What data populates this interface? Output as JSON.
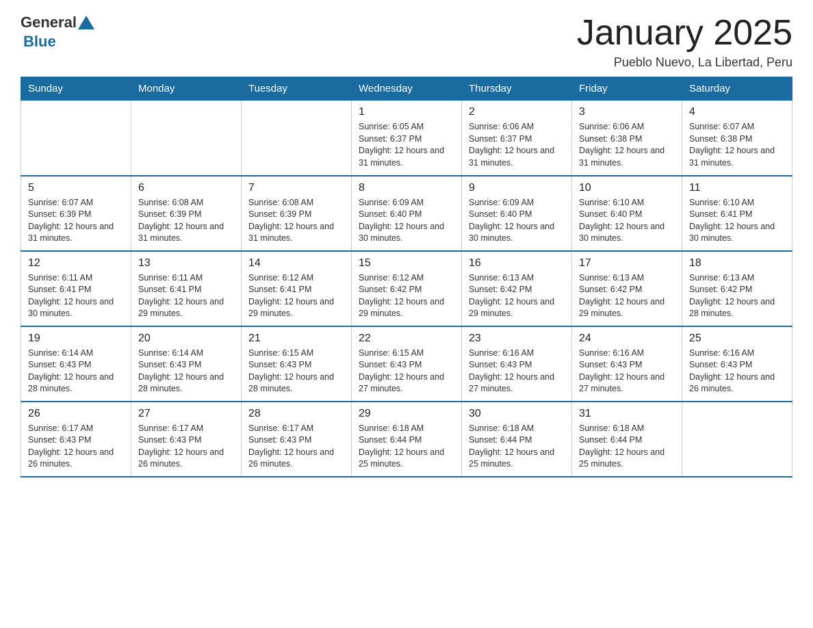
{
  "header": {
    "logo_general": "General",
    "logo_blue": "Blue",
    "month_title": "January 2025",
    "location": "Pueblo Nuevo, La Libertad, Peru"
  },
  "days_of_week": [
    "Sunday",
    "Monday",
    "Tuesday",
    "Wednesday",
    "Thursday",
    "Friday",
    "Saturday"
  ],
  "weeks": [
    [
      {
        "day": "",
        "info": ""
      },
      {
        "day": "",
        "info": ""
      },
      {
        "day": "",
        "info": ""
      },
      {
        "day": "1",
        "info": "Sunrise: 6:05 AM\nSunset: 6:37 PM\nDaylight: 12 hours and 31 minutes."
      },
      {
        "day": "2",
        "info": "Sunrise: 6:06 AM\nSunset: 6:37 PM\nDaylight: 12 hours and 31 minutes."
      },
      {
        "day": "3",
        "info": "Sunrise: 6:06 AM\nSunset: 6:38 PM\nDaylight: 12 hours and 31 minutes."
      },
      {
        "day": "4",
        "info": "Sunrise: 6:07 AM\nSunset: 6:38 PM\nDaylight: 12 hours and 31 minutes."
      }
    ],
    [
      {
        "day": "5",
        "info": "Sunrise: 6:07 AM\nSunset: 6:39 PM\nDaylight: 12 hours and 31 minutes."
      },
      {
        "day": "6",
        "info": "Sunrise: 6:08 AM\nSunset: 6:39 PM\nDaylight: 12 hours and 31 minutes."
      },
      {
        "day": "7",
        "info": "Sunrise: 6:08 AM\nSunset: 6:39 PM\nDaylight: 12 hours and 31 minutes."
      },
      {
        "day": "8",
        "info": "Sunrise: 6:09 AM\nSunset: 6:40 PM\nDaylight: 12 hours and 30 minutes."
      },
      {
        "day": "9",
        "info": "Sunrise: 6:09 AM\nSunset: 6:40 PM\nDaylight: 12 hours and 30 minutes."
      },
      {
        "day": "10",
        "info": "Sunrise: 6:10 AM\nSunset: 6:40 PM\nDaylight: 12 hours and 30 minutes."
      },
      {
        "day": "11",
        "info": "Sunrise: 6:10 AM\nSunset: 6:41 PM\nDaylight: 12 hours and 30 minutes."
      }
    ],
    [
      {
        "day": "12",
        "info": "Sunrise: 6:11 AM\nSunset: 6:41 PM\nDaylight: 12 hours and 30 minutes."
      },
      {
        "day": "13",
        "info": "Sunrise: 6:11 AM\nSunset: 6:41 PM\nDaylight: 12 hours and 29 minutes."
      },
      {
        "day": "14",
        "info": "Sunrise: 6:12 AM\nSunset: 6:41 PM\nDaylight: 12 hours and 29 minutes."
      },
      {
        "day": "15",
        "info": "Sunrise: 6:12 AM\nSunset: 6:42 PM\nDaylight: 12 hours and 29 minutes."
      },
      {
        "day": "16",
        "info": "Sunrise: 6:13 AM\nSunset: 6:42 PM\nDaylight: 12 hours and 29 minutes."
      },
      {
        "day": "17",
        "info": "Sunrise: 6:13 AM\nSunset: 6:42 PM\nDaylight: 12 hours and 29 minutes."
      },
      {
        "day": "18",
        "info": "Sunrise: 6:13 AM\nSunset: 6:42 PM\nDaylight: 12 hours and 28 minutes."
      }
    ],
    [
      {
        "day": "19",
        "info": "Sunrise: 6:14 AM\nSunset: 6:43 PM\nDaylight: 12 hours and 28 minutes."
      },
      {
        "day": "20",
        "info": "Sunrise: 6:14 AM\nSunset: 6:43 PM\nDaylight: 12 hours and 28 minutes."
      },
      {
        "day": "21",
        "info": "Sunrise: 6:15 AM\nSunset: 6:43 PM\nDaylight: 12 hours and 28 minutes."
      },
      {
        "day": "22",
        "info": "Sunrise: 6:15 AM\nSunset: 6:43 PM\nDaylight: 12 hours and 27 minutes."
      },
      {
        "day": "23",
        "info": "Sunrise: 6:16 AM\nSunset: 6:43 PM\nDaylight: 12 hours and 27 minutes."
      },
      {
        "day": "24",
        "info": "Sunrise: 6:16 AM\nSunset: 6:43 PM\nDaylight: 12 hours and 27 minutes."
      },
      {
        "day": "25",
        "info": "Sunrise: 6:16 AM\nSunset: 6:43 PM\nDaylight: 12 hours and 26 minutes."
      }
    ],
    [
      {
        "day": "26",
        "info": "Sunrise: 6:17 AM\nSunset: 6:43 PM\nDaylight: 12 hours and 26 minutes."
      },
      {
        "day": "27",
        "info": "Sunrise: 6:17 AM\nSunset: 6:43 PM\nDaylight: 12 hours and 26 minutes."
      },
      {
        "day": "28",
        "info": "Sunrise: 6:17 AM\nSunset: 6:43 PM\nDaylight: 12 hours and 26 minutes."
      },
      {
        "day": "29",
        "info": "Sunrise: 6:18 AM\nSunset: 6:44 PM\nDaylight: 12 hours and 25 minutes."
      },
      {
        "day": "30",
        "info": "Sunrise: 6:18 AM\nSunset: 6:44 PM\nDaylight: 12 hours and 25 minutes."
      },
      {
        "day": "31",
        "info": "Sunrise: 6:18 AM\nSunset: 6:44 PM\nDaylight: 12 hours and 25 minutes."
      },
      {
        "day": "",
        "info": ""
      }
    ]
  ]
}
